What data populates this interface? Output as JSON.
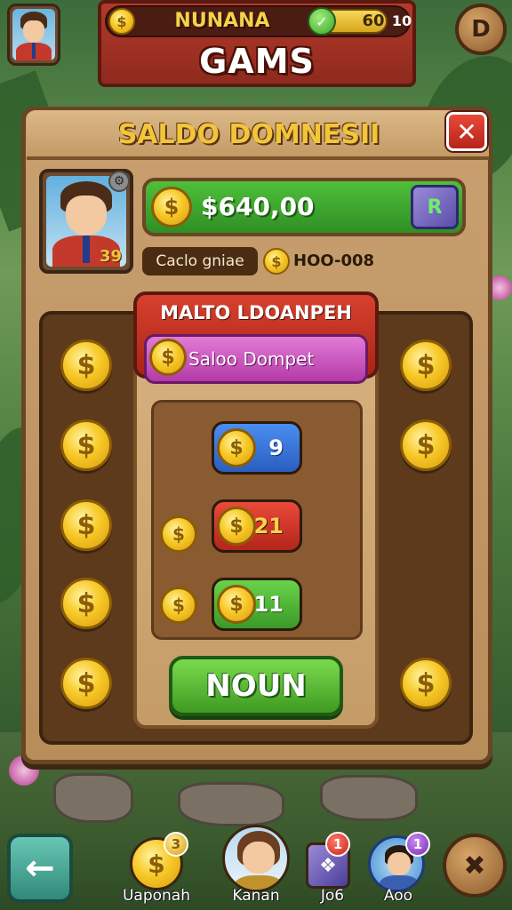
{
  "top_bar": {
    "player_name": "NUNANA",
    "energy_value": "60",
    "level_value": "10",
    "title": "GAMS",
    "coin_symbol": "$",
    "energy_symbol": "✓",
    "right_button_symbol": "D"
  },
  "panel": {
    "title": "SALDO DOMNESII",
    "close_symbol": "✕",
    "profile_badge": "39",
    "balance_value": "$640,00",
    "wallet_symbol": "R",
    "sub_label": "Caclo gniae",
    "sub_value": "HOO-008",
    "sign_title": "MALTO LDOANPEH",
    "pink_pill_text": "Saloo Dompet",
    "pills": [
      {
        "value": "9",
        "color": "blue"
      },
      {
        "value": "21",
        "color": "red"
      },
      {
        "value": "11",
        "color": "green"
      }
    ],
    "action_button": "NOUN"
  },
  "bottom_nav": {
    "back_symbol": "←",
    "items": [
      {
        "label": "Uaponah",
        "badge": "3"
      },
      {
        "label": "Kanan",
        "badge": ""
      },
      {
        "label": "Jo6",
        "badge": "1"
      },
      {
        "label": "Aoo",
        "badge": "1"
      }
    ]
  },
  "colors": {
    "coin_gold": "#f7c928",
    "panel_wood": "#c9a070",
    "title_gold": "#f2c53a",
    "action_green": "#4fbf3a",
    "close_red": "#e84a3a"
  }
}
